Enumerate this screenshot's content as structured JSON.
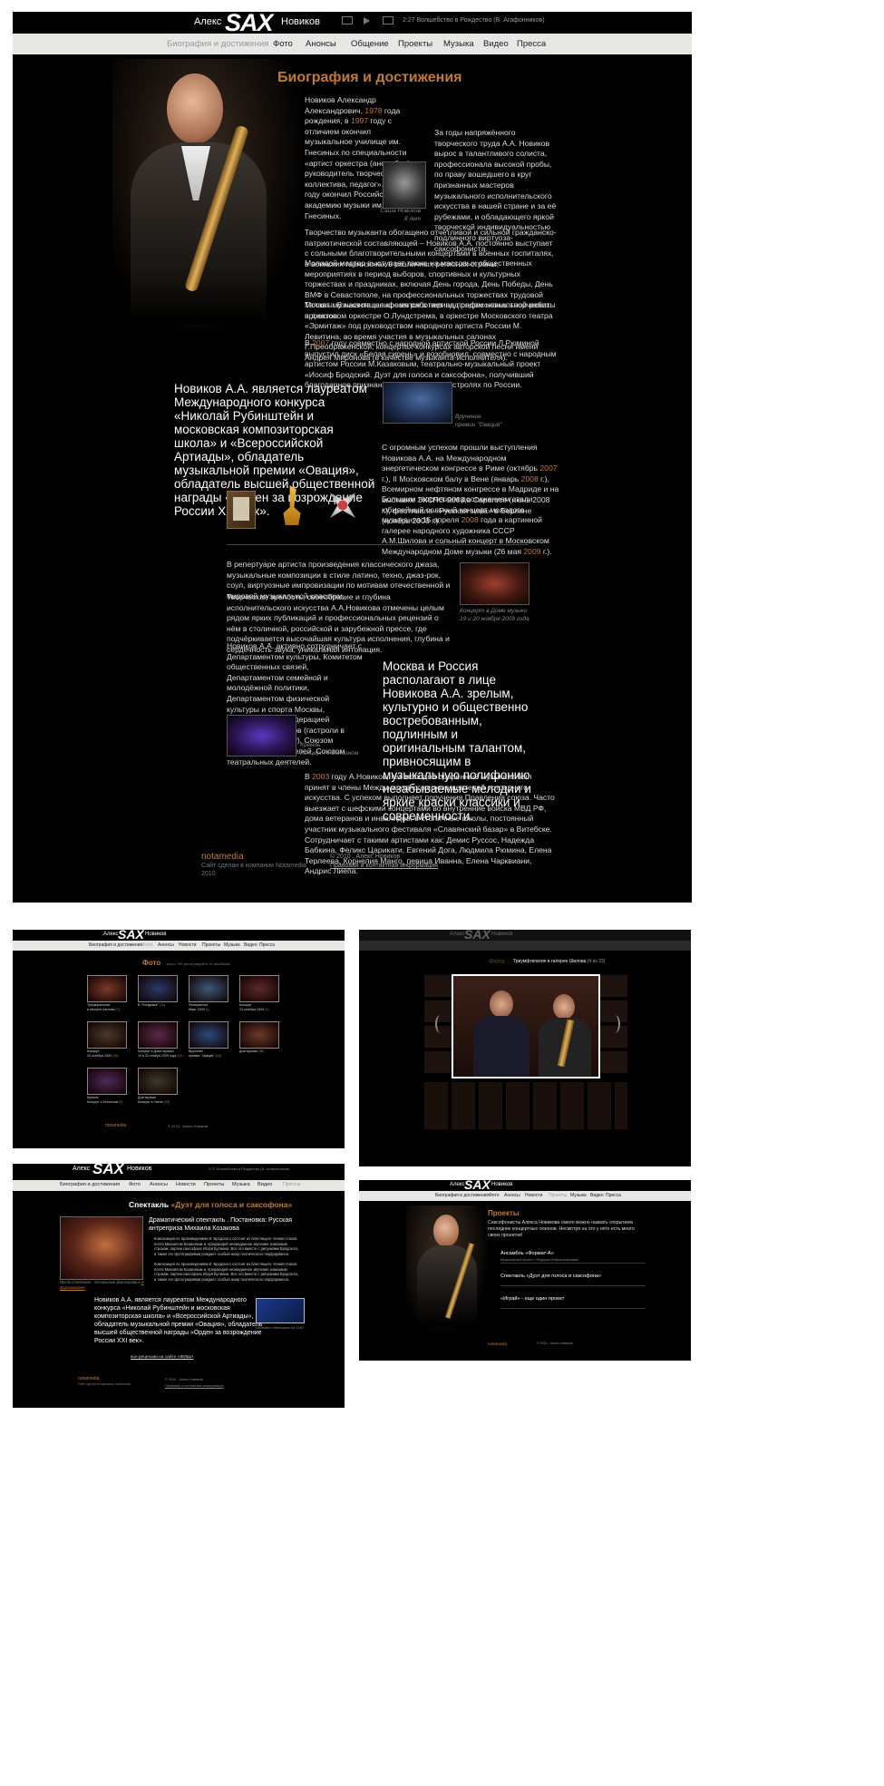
{
  "logo": {
    "first": "Алекс",
    "sax": "SAX",
    "last": "Новиков"
  },
  "player": {
    "now_playing": "2:27 Волшебство в Рождество (В. Агафонников)"
  },
  "nav": [
    "Биография и достижения",
    "Фото",
    "Анонсы",
    "Общение",
    "Проекты",
    "Музыка",
    "Видео",
    "Пресса"
  ],
  "nav_mini": [
    "Биография и достижения",
    "Фото",
    "Анонсы",
    "Новости",
    "Проекты",
    "Музыка",
    "Видео",
    "Пресса"
  ],
  "bio": {
    "title": "Биография и достижения",
    "intro_a": "Новиков Александр Александрович, ",
    "intro_y1": "1978",
    "intro_b": " года рождения, в ",
    "intro_y2": "1997",
    "intro_c": " году с отличием окончил музыкальное училище им. Гнесиных по специальности «артист оркестра (ансамбля), руководитель творческого коллектива, педагог». В ",
    "intro_y3": "2002",
    "intro_d": " году окончил Российскую академию музыки им. Гнесиных.",
    "right_text": "За годы напряжённого творческого труда А.А. Новиков вырос в талантливого солиста, профессионала высокой пробы, по праву вошедшего в круг признанных мастеров музыкального исполнительского искусства в нашей стране и за её рубежами, и обладающего яркой творческой индивидуальностью подлинного виртуоза-саксофониста.",
    "child_caption_1": "Саша Новиков",
    "child_caption_2": "8 лет",
    "p1": "Творчество музыканта обогащено отчётливой и сильной гражданско-патриотической составляющей – Новиков А.А. постоянно выступает с сольными благотворительными концертами в военных госпиталях, в воинских гарнизонах в различных регионах страны.",
    "p2": "Молодой мастер выступает также на массовых общественных мероприятиях в период выборов, спортивных и культурных торжествах и праздниках, включая День города, День Победы, День ВМФ в Севастополе, на профессиональных торжествах трудовой Москвы. В настоящее время работает над рядом новых творческих проектов.",
    "p3": "Талант музыканта шлифовался в период профессиональной работы в джазовом оркестре О.Лундстрема, в оркестре Московского театра «Эрмитаж» под руководством народного артиста России М. Левитина, во время участия в музыкальных салонах Г.Преображенской, концертах-конкурсах авторской песни имени Андрея Миронова (в качестве музыканта-исполнителя).",
    "p4_a": "В ",
    "p4_y": "2007",
    "p4_b": " году совместно с народной артисткой России Л.Рюминой выпустил диск «Белая сирень» и возобновил, совместно с народным артистом России М.Казаковым, театрально-музыкальный проект «Иосиф Бродский. Дуэт для голоса и саксофона», получивший благодарное признание в Москве и на гастролях по России.",
    "laureate": "Новиков А.А. является лауреатом Международного конкурса «Николай Рубинштейн и московская композиторская школа» и «Всероссийской Артиады», обладатель музыкальной премии «Овация», обладатель высшей общественной награды «Орден за возрождение России XXI век».",
    "ovation_caption_1": "Вручение",
    "ovation_caption_2": "премии \"Овация\"",
    "p5_a": "С огромным успехом прошли выступления Новикова А.А. на Международном энергетическом конгрессе в Риме (октябрь ",
    "p5_y1": "2007",
    "p5_b": " г.), II Московском балу в Вене (январь ",
    "p5_y2": "2008",
    "p5_c": " г.), Всемирном нефтяном конгрессе в Мадриде и на выставке ЭКСПО-2008 в Сарагосе (июнь 2008 г.), фестивале «Русская зима» в Берлине (ноябрь 2008 г.).",
    "p6_a": "Большим творческим достижением стали юбилейный сольный концерт молодого музыканта 15 апреля ",
    "p6_y1": "2008",
    "p6_b": " года в картинной галерее народного художника СССР А.М.Шилова и сольный концерт в Московском Международном Доме музыки (26 мая ",
    "p6_y2": "2009",
    "p6_c": " г.).",
    "p7": "В репертуаре артиста произведения классического джаза, музыкальные композиции в стиле латино, техно, джаз-рок, соул, виртуозные импровизации по мотивам отечественной и мировой музыкальной классики.",
    "p8": "Творческая зрелость, своеобразие и глубина исполнительского искусства А.А.Новикова отмечены целым рядом ярких публикаций и профессиональных рецензий о нём в столичной, российской и зарубежной прессе, где подчёркивается высочайшая культура исполнения, глубина и сердечность звука, уникальная интонация.",
    "concert_caption_1": "Концерт в Доме музыки",
    "concert_caption_2": "19 и 20 ноября 2009 года",
    "p9_a": "Новиков А.А. активно сотрудничает с Департаментом культуры, Комитетом общественных связей, Департаментом семейной и молодёжной политики, Департаментом физической культуры и спорта Москвы, Московской конфедерацией театральных союзов (гастроли в Японии в ",
    "p9_y": "2006",
    "p9_b": " году), Союзом музыкальных деятелей, Союзом театральных деятелей.",
    "moscow": "Москва и Россия располагают в лице Новикова А.А. зрелым, культурно и общественно востребованным, подлинным и оригинальным талантом, привносящим в музыкальную полифонию незабываемые мелодии и яркие краски классики и современности.",
    "kremlin_caption_1": "Кремль",
    "kremlin_caption_2": "Концерт с Бенсоном",
    "p10_a": "В ",
    "p10_y": "2003",
    "p10_b": " году А.Новиков, как молодой одаренный музыкант был принят в члены Международного союза деятелей эстрадного искусства. С успехом выполняет поручения Правления союза. Часто выезжает с шефскими концертами во внутренние войска МВД РФ, дома ветеранов и инвалидов, в столичные школы, постоянный участник музыкального фестиваля «Славянский базар» в Витебске. Сотрудничает с такими артистами как: Демис Руссос, Надежда Бабкина, Феликс Царикати, Евгений Дога, Людмила Рюмина, Елена Терлеева, Корнелия Манго, певица Иванна, Елена Чарквиани, Андрис Лиепа."
  },
  "footer": {
    "notamedia": "notamedia",
    "made_by": "Сайт сделан в компании Notamedia",
    "year": "2010",
    "copyright": "© 2010 . Алекс Новиков",
    "legal": "Правовая и контактная информация"
  },
  "photo_page": {
    "title": "Фото",
    "count": "всего 780 фотографий в 10 альбомах",
    "albums": [
      {
        "name": "Триумфальная",
        "sub": "в галерее Шилова",
        "n": "(7)"
      },
      {
        "name": "В \"Гнездовье\"",
        "sub": "",
        "n": "(11)"
      },
      {
        "name": "Филармония",
        "sub": "Март 2009",
        "n": "(1)"
      },
      {
        "name": "Концерт",
        "sub": "23 октября 2009",
        "n": "(1)"
      },
      {
        "name": "Концерт",
        "sub": "20 октября 2009",
        "n": "(18)"
      },
      {
        "name": "Концерт в Доме музыки",
        "sub": "19 и 20 ноября 2009 года",
        "n": "(21)"
      },
      {
        "name": "Вручение",
        "sub": "премии \"Овация\"",
        "n": "(15)"
      },
      {
        "name": "Дом музыки",
        "sub": "",
        "n": "(48)"
      },
      {
        "name": "Кремль",
        "sub": "Концерт с Бенсоном",
        "n": "(9)"
      },
      {
        "name": "Дом музыки",
        "sub": "Концерт в Гжеле",
        "n": "(25)"
      }
    ]
  },
  "gallery": {
    "title": "Фото",
    "caption": "Триумфтипатия в галерее Шилова",
    "counter": "(4 из 33)"
  },
  "spectacle": {
    "title_a": "Спектакль ",
    "title_b": "«Дуэт для голоса и саксофона»",
    "subtitle": "Драматический спектакль . Постановка: Русская антреприза Михаила Козакова",
    "text1": "Композиция по произведениям И. Бродского состоит из блестящего чтения стихов поэта Михаилом Козаковым и, предающей неожиданное звучание знакомым строкам, партии саксофона Игоря Бутмана. Все это вместе с рисунками Бродского, а также его фотографиями рождает особый жанр поэтического перформанса.",
    "text2": "Композиция по произведениям И. Бродского состоит из блестящего чтения стихов поэта Михаилом Козаковым и, предающей неожиданное звучание знакомым строкам, партии саксофона Игоря Бутмана. Все это вместе с рисунками Бродского, а также его фотографиями рождает особый жанр поэтического перформанса.",
    "photo_caption": "После спектакля . Остальные фотографии",
    "photo_link": "в фотогалерее",
    "dvd_caption": "Обложка спектакля на DVD",
    "reviews": "все рецензии на сайте АФИША"
  },
  "projects": {
    "title": "Проекты",
    "intro": "Саксофонисты Алекса Новикова смело можно назвать открытием последних концертных сезонов. Несмотря на это у него есть много своих проектов!",
    "items": [
      {
        "name": "Ансамбль «Формат-А»",
        "desc": "Музыкальный проект с Фёдором Нефтюльниковым"
      },
      {
        "name": "Спектакль «Дуэт для голоса и саксофона»",
        "desc": ""
      },
      {
        "name": "«Играй» - еще один проект",
        "desc": ""
      }
    ]
  },
  "colors": {
    "accent": "#c07a35",
    "nav_bg": "#e9e7e3",
    "bg": "#000000"
  }
}
